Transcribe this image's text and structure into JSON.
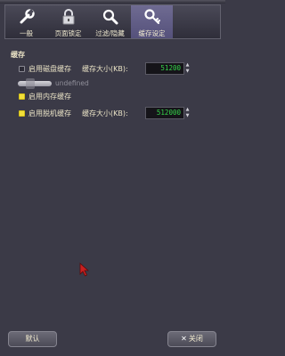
{
  "tabs": [
    {
      "label": "一般",
      "icon": "wrench-icon"
    },
    {
      "label": "页面锁定",
      "icon": "lock-icon"
    },
    {
      "label": "过滤/隐藏",
      "icon": "magnifier-icon"
    },
    {
      "label": "缓存设定",
      "icon": "key-icon",
      "active": true
    }
  ],
  "cache": {
    "section_title": "缓存",
    "disk": {
      "label": "启用磁盘缓存",
      "checked": false,
      "size_label": "缓存大小(KB):",
      "size_value": "51200"
    },
    "slider_label": "undefined",
    "memory": {
      "label": "启用内存缓存",
      "checked": true
    },
    "offline": {
      "label": "启用脱机缓存",
      "checked": true,
      "size_label": "缓存大小(KB):",
      "size_value": "512000"
    }
  },
  "buttons": {
    "default_label": "默认",
    "close_label": "关闭"
  },
  "colors": {
    "background": "#3b3a47",
    "active_tab": "#6f6b92",
    "spin_text": "#36d44a",
    "checkbox_on": "#f2df3a"
  }
}
